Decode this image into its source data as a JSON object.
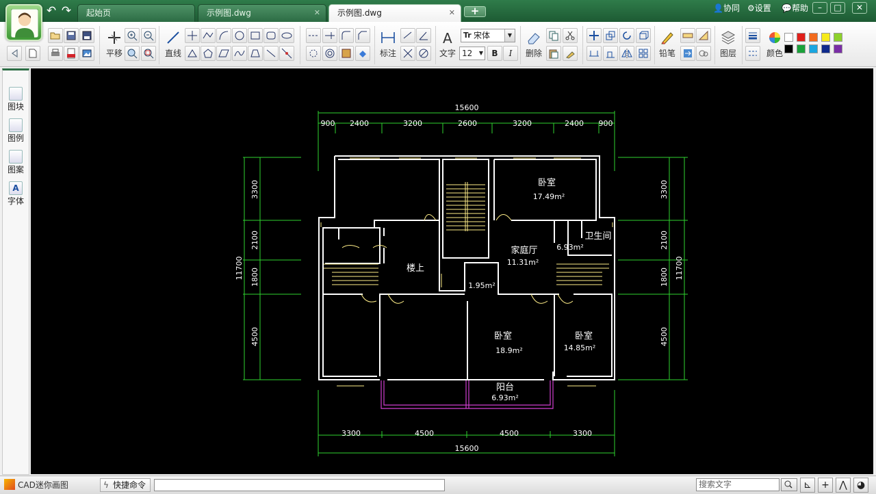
{
  "app": {
    "name": "CAD迷你画图"
  },
  "tabs": [
    {
      "label": "起始页",
      "state": "inactive"
    },
    {
      "label": "示例图.dwg",
      "state": "inactive"
    },
    {
      "label": "示例图.dwg",
      "state": "active"
    }
  ],
  "header_menu": {
    "collab": "协同",
    "settings": "设置",
    "help": "帮助"
  },
  "ribbon": {
    "pan_label": "平移",
    "line_label": "直线",
    "dim_label": "标注",
    "text_label": "文字",
    "font_name": "宋体",
    "font_size": "12",
    "bold": "B",
    "italic": "I",
    "delete_label": "删除",
    "pencil_label": "铅笔",
    "layer_label": "图层",
    "color_label": "颜色",
    "palette": [
      "#ffffff",
      "#e0201b",
      "#f26b1d",
      "#f6ea1a",
      "#8dd12c",
      "#000000",
      "#1aa23a",
      "#1aa6e0",
      "#0f2a8c",
      "#7a2ea6"
    ]
  },
  "left_panel": [
    {
      "label": "图块",
      "icon": "blocks-icon"
    },
    {
      "label": "图例",
      "icon": "legend-icon"
    },
    {
      "label": "图案",
      "icon": "hatch-icon"
    },
    {
      "label": "字体",
      "icon": "font-icon"
    }
  ],
  "drawing": {
    "total_width": "15600",
    "top_dims": [
      "900",
      "2400",
      "3200",
      "2600",
      "3200",
      "2400",
      "900"
    ],
    "bottom_dims": [
      "3300",
      "4500",
      "4500",
      "3300"
    ],
    "side_dims": [
      "3300",
      "2100",
      "1800",
      "4500"
    ],
    "total_height": "11700",
    "rooms": [
      {
        "name": "卧室",
        "area": "17.49m²"
      },
      {
        "name": "卫生间",
        "area": "6.93m²"
      },
      {
        "name": "家庭厅",
        "area": "11.31m²"
      },
      {
        "name": "楼上",
        "area": ""
      },
      {
        "name": "",
        "area": "1.95m²"
      },
      {
        "name": "卧室",
        "area": "18.9m²"
      },
      {
        "name": "卧室",
        "area": "14.85m²"
      },
      {
        "name": "阳台",
        "area": "6.93m²"
      }
    ]
  },
  "status": {
    "quick_cmd": "快捷命令",
    "search_placeholder": "搜索文字",
    "cmd_value": ""
  }
}
